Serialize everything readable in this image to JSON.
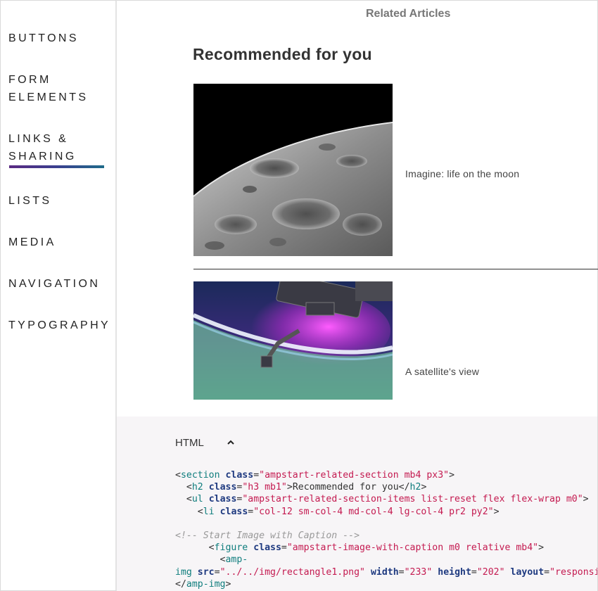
{
  "sidebar": {
    "items": [
      {
        "label": "Buttons"
      },
      {
        "label": "Form"
      },
      {
        "label": "Elements"
      },
      {
        "label": "Links &"
      },
      {
        "label": "Sharing"
      },
      {
        "label": "Lists"
      },
      {
        "label": "Media"
      },
      {
        "label": "Navigation"
      },
      {
        "label": "Typography"
      }
    ],
    "active": "Links & Sharing",
    "accent_colors": [
      "#5a2a82",
      "#1f6b8a"
    ]
  },
  "main": {
    "section_title": "Related Articles",
    "heading": "Recommended for you",
    "articles": [
      {
        "caption": "Imagine: life on the moon",
        "image": "moon-surface"
      },
      {
        "caption": "A satellite's view",
        "image": "space-station-aurora"
      }
    ]
  },
  "code_panel": {
    "label": "HTML",
    "toggle_icon": "chevron-up-icon",
    "lines": {
      "l1_open": "<",
      "l1_tag": "section",
      "l1_attr": "class",
      "l1_eq": "=",
      "l1_val": "\"ampstart-related-section mb4 px3\"",
      "l1_close": ">",
      "l2_open": "<",
      "l2_tag": "h2",
      "l2_attr": "class",
      "l2_eq": "=",
      "l2_val": "\"h3 mb1\"",
      "l2_text": ">Recommended for you</",
      "l2_tag2": "h2",
      "l2_close": ">",
      "l3_open": "<",
      "l3_tag": "ul",
      "l3_attr": "class",
      "l3_eq": "=",
      "l3_val": "\"ampstart-related-section-items list-reset flex flex-wrap m0\"",
      "l3_close": ">",
      "l4_open": "<",
      "l4_tag": "li",
      "l4_attr": "class",
      "l4_eq": "=",
      "l4_val": "\"col-12 sm-col-4 md-col-4 lg-col-4 pr2 py2\"",
      "l4_close": ">",
      "l5_comment": "<!-- Start Image with Caption -->",
      "l6_open": "<",
      "l6_tag": "figure",
      "l6_attr": "class",
      "l6_eq": "=",
      "l6_val": "\"ampstart-image-with-caption m0 relative mb4\"",
      "l6_close": ">",
      "l7_open": "<",
      "l7_tag": "amp-",
      "l8_tag": "img",
      "l8_a1": "src",
      "l8_v1": "\"../../img/rectangle1.png\"",
      "l8_a2": "width",
      "l8_v2": "\"233\"",
      "l8_a3": "height",
      "l8_v3": "\"202\"",
      "l8_a4": "layout",
      "l8_v4": "\"responsive\"",
      "l9_open": "</",
      "l9_tag": "amp-img",
      "l9_close": ">"
    }
  }
}
